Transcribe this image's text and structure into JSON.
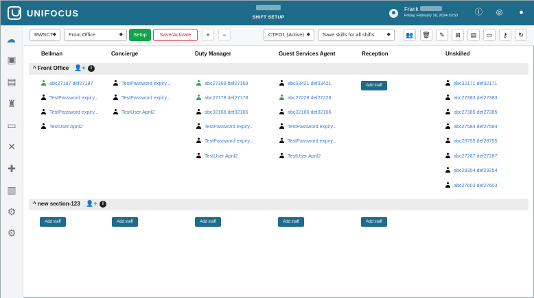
{
  "header": {
    "brand": "UNIFOCUS",
    "subtitle": "SHIFT SETUP",
    "user_name": "Frank",
    "date_text": "Friday, February 16, 2024 10:53",
    "icons": [
      "user-icon",
      "info-icon",
      "compass-icon",
      "bell-icon"
    ],
    "brand_color": "#1f6b8a"
  },
  "sidebar": {
    "items": [
      "weather-dashboard-icon",
      "calculator-icon",
      "clipboard-icon",
      "housekeeping-icon",
      "bed-icon",
      "tools-icon",
      "plus-icon",
      "chart-icon",
      "settings-user-icon",
      "settings-icon"
    ]
  },
  "toolbar": {
    "property": "RWSCT",
    "department": "Front Office",
    "setup": "Setup",
    "save": "Save/Activate",
    "add": "+",
    "remove": "−",
    "ctfo": "CTFO1 (Active)",
    "skills": "Save skills for all shifts",
    "icon_names": [
      "users-icon",
      "trash-icon",
      "edit-icon",
      "add-box-icon",
      "id-card-icon",
      "note-icon",
      "key-icon",
      "refresh-icon"
    ]
  },
  "columns": [
    "Bellman",
    "Concierge",
    "Duty Manager",
    "Guest Services Agent",
    "Reception",
    "Unskilled"
  ],
  "sections": [
    {
      "name": "Front Office",
      "staff": [
        [
          {
            "name": "abc27187 def27187",
            "status": "green"
          },
          {
            "name": "TestPassword expiry...",
            "status": "black"
          },
          {
            "name": "TestPassword expiry...",
            "status": "black"
          },
          {
            "name": "TestUser April2",
            "status": "black"
          }
        ],
        [
          {
            "name": "TestPassword expiry...",
            "status": "black"
          },
          {
            "name": "TestPassword expiry...",
            "status": "black"
          },
          {
            "name": "TestUser April2",
            "status": "black"
          }
        ],
        [
          {
            "name": "abc27169 def27169",
            "status": "green"
          },
          {
            "name": "abc27178 def27178",
            "status": "green"
          },
          {
            "name": "abc32166 def32166",
            "status": "black"
          },
          {
            "name": "TestPassword expiry...",
            "status": "black"
          },
          {
            "name": "TestPassword expiry...",
            "status": "black"
          },
          {
            "name": "TestUser April2",
            "status": "black"
          }
        ],
        [
          {
            "name": "abc33421 def33421",
            "status": "black"
          },
          {
            "name": "abc27228 def27228",
            "status": "green"
          },
          {
            "name": "abc32166 def32166",
            "status": "black"
          },
          {
            "name": "TestPassword expiry...",
            "status": "black"
          },
          {
            "name": "TestPassword expiry...",
            "status": "black"
          },
          {
            "name": "TestUser April2",
            "status": "black"
          }
        ],
        [],
        [
          {
            "name": "abc32171 def32171",
            "status": "black"
          },
          {
            "name": "abc27383 def27383",
            "status": "black"
          },
          {
            "name": "abc27385 def27385",
            "status": "black"
          },
          {
            "name": "abc27584 def27584",
            "status": "black"
          },
          {
            "name": "abc28755 def28755",
            "status": "black"
          },
          {
            "name": "abc27287 def27287",
            "status": "black"
          },
          {
            "name": "abc29354 def29354",
            "status": "black"
          },
          {
            "name": "abc27603 def27603",
            "status": "black"
          }
        ]
      ],
      "add_label": "Add staff"
    },
    {
      "name": "new section-123",
      "add_label": "Add staff"
    }
  ]
}
